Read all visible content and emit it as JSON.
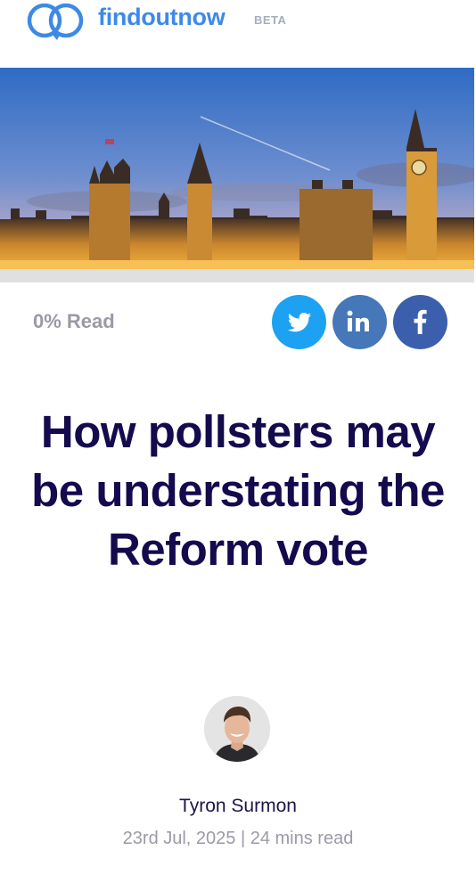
{
  "header": {
    "brand": "findoutnow",
    "badge": "BETA",
    "brand_color": "#3d8ae6"
  },
  "hero": {
    "icon": "houses-of-parliament-photo"
  },
  "reading_progress": {
    "label": "0% Read",
    "percent": 0
  },
  "share": {
    "twitter": {
      "label": "Twitter",
      "icon": "twitter-bird-icon",
      "color": "#1da1f2"
    },
    "linkedin": {
      "label": "in",
      "icon": "linkedin-icon",
      "color": "#4577b9"
    },
    "facebook": {
      "label": "f",
      "icon": "facebook-icon",
      "color": "#3b5fac"
    }
  },
  "article": {
    "title": "How pollsters may be understating the Reform vote",
    "title_color": "#140a4e",
    "author": "Tyron Surmon",
    "meta": "23rd Jul, 2025 | 24 mins read"
  }
}
